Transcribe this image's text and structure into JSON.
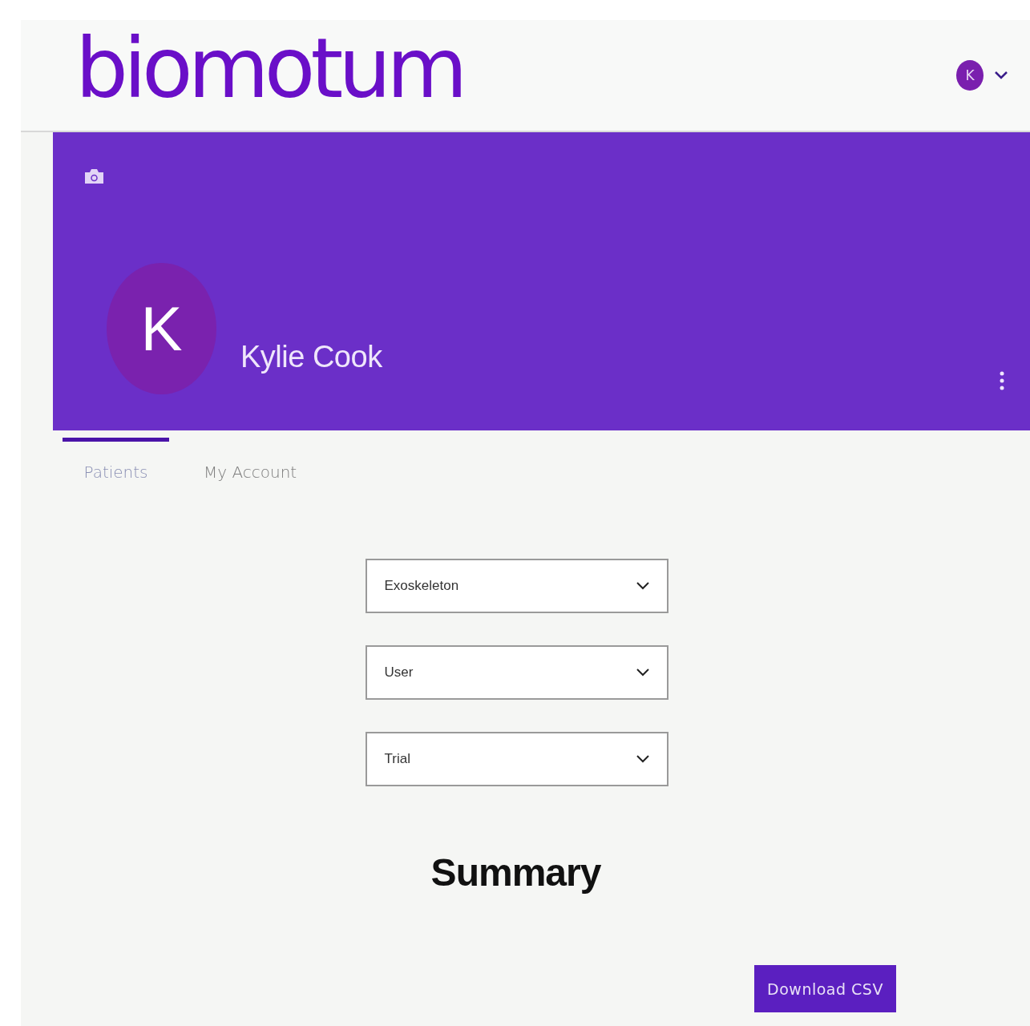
{
  "header": {
    "logo": "biomotum",
    "user_avatar": "K"
  },
  "profile": {
    "avatar": "K",
    "name": "Kylie Cook"
  },
  "tabs": [
    {
      "label": "Patients",
      "selected": true
    },
    {
      "label": "My Account",
      "selected": false
    }
  ],
  "filters": [
    {
      "value": "Exoskeleton"
    },
    {
      "value": "User"
    },
    {
      "value": "Trial"
    }
  ],
  "summary": {
    "title": "Summary",
    "button": "Download CSV"
  }
}
